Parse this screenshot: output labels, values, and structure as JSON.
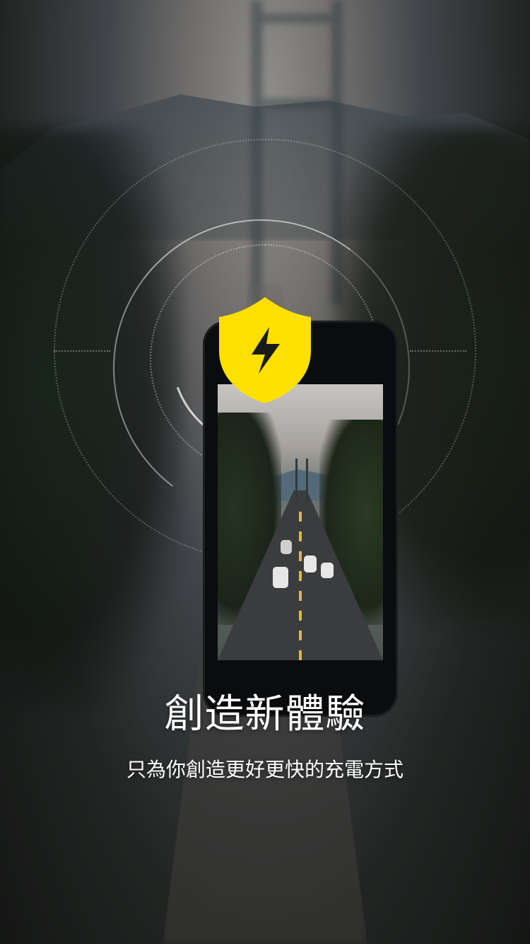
{
  "onboarding": {
    "title": "創造新體驗",
    "subtitle": "只為你創造更好更快的充電方式"
  },
  "icons": {
    "shield": "yellow-shield-lightning-icon"
  },
  "colors": {
    "accent_yellow": "#FFE000",
    "text_white": "#FFFFFF"
  }
}
